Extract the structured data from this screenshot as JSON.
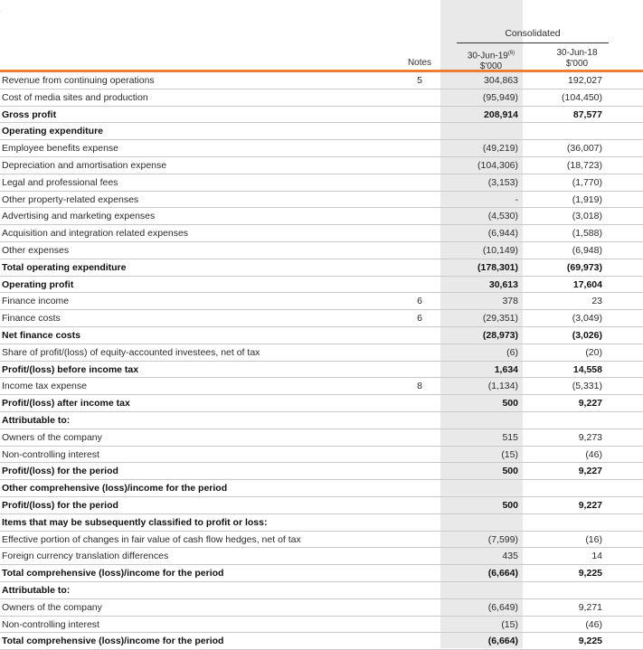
{
  "header": {
    "consolidated": "Consolidated",
    "notes": "Notes",
    "col_2019": {
      "date": "30-Jun-19",
      "sup": "(6)",
      "unit": "$'000"
    },
    "col_2018": {
      "date": "30-Jun-18",
      "unit": "$'000"
    }
  },
  "rows": [
    {
      "label": "Revenue from continuing operations",
      "note": "5",
      "v19": "304,863",
      "v18": "192,027",
      "bold": false
    },
    {
      "label": "Cost of media sites and production",
      "note": "",
      "v19": "(95,949)",
      "v18": "(104,450)",
      "bold": false
    },
    {
      "label": "Gross profit",
      "note": "",
      "v19": "208,914",
      "v18": "87,577",
      "bold": true
    },
    {
      "label": "Operating expenditure",
      "note": "",
      "v19": "",
      "v18": "",
      "bold": true
    },
    {
      "label": "Employee benefits expense",
      "note": "",
      "v19": "(49,219)",
      "v18": "(36,007)",
      "bold": false
    },
    {
      "label": "Depreciation and amortisation expense",
      "note": "",
      "v19": "(104,306)",
      "v18": "(18,723)",
      "bold": false
    },
    {
      "label": "Legal and professional fees",
      "note": "",
      "v19": "(3,153)",
      "v18": "(1,770)",
      "bold": false
    },
    {
      "label": "Other property-related expenses",
      "note": "",
      "v19": "-",
      "v18": "(1,919)",
      "bold": false
    },
    {
      "label": "Advertising and marketing expenses",
      "note": "",
      "v19": "(4,530)",
      "v18": "(3,018)",
      "bold": false
    },
    {
      "label": "Acquisition and integration related expenses",
      "note": "",
      "v19": "(6,944)",
      "v18": "(1,588)",
      "bold": false
    },
    {
      "label": "Other expenses",
      "note": "",
      "v19": "(10,149)",
      "v18": "(6,948)",
      "bold": false
    },
    {
      "label": "Total operating expenditure",
      "note": "",
      "v19": "(178,301)",
      "v18": "(69,973)",
      "bold": true
    },
    {
      "label": "Operating profit",
      "note": "",
      "v19": "30,613",
      "v18": "17,604",
      "bold": true
    },
    {
      "label": "Finance income",
      "note": "6",
      "v19": "378",
      "v18": "23",
      "bold": false
    },
    {
      "label": "Finance costs",
      "note": "6",
      "v19": "(29,351)",
      "v18": "(3,049)",
      "bold": false
    },
    {
      "label": "Net finance costs",
      "note": "",
      "v19": "(28,973)",
      "v18": "(3,026)",
      "bold": true
    },
    {
      "label": "Share of profit/(loss) of equity-accounted investees, net of tax",
      "note": "",
      "v19": "(6)",
      "v18": "(20)",
      "bold": false
    },
    {
      "label": "Profit/(loss) before income tax",
      "note": "",
      "v19": "1,634",
      "v18": "14,558",
      "bold": true
    },
    {
      "label": "Income tax expense",
      "note": "8",
      "v19": "(1,134)",
      "v18": "(5,331)",
      "bold": false
    },
    {
      "label": "Profit/(loss) after income tax",
      "note": "",
      "v19": "500",
      "v18": "9,227",
      "bold": true
    },
    {
      "label": "Attributable to:",
      "note": "",
      "v19": "",
      "v18": "",
      "bold": true
    },
    {
      "label": "Owners of the company",
      "note": "",
      "v19": "515",
      "v18": "9,273",
      "bold": false
    },
    {
      "label": "Non-controlling interest",
      "note": "",
      "v19": "(15)",
      "v18": "(46)",
      "bold": false
    },
    {
      "label": "Profit/(loss) for the period",
      "note": "",
      "v19": "500",
      "v18": "9,227",
      "bold": true
    },
    {
      "label": "Other comprehensive (loss)/income for the period",
      "note": "",
      "v19": "",
      "v18": "",
      "bold": true
    },
    {
      "label": "Profit/(loss) for the period",
      "note": "",
      "v19": "500",
      "v18": "9,227",
      "bold": true
    },
    {
      "label": "Items that may be subsequently classified to profit or loss:",
      "note": "",
      "v19": "",
      "v18": "",
      "bold": true
    },
    {
      "label": "Effective portion of changes in fair value of cash flow hedges, net of tax",
      "note": "",
      "v19": "(7,599)",
      "v18": "(16)",
      "bold": false
    },
    {
      "label": "Foreign currency translation differences",
      "note": "",
      "v19": "435",
      "v18": "14",
      "bold": false
    },
    {
      "label": "Total comprehensive (loss)/income for the period",
      "note": "",
      "v19": "(6,664)",
      "v18": "9,225",
      "bold": true
    },
    {
      "label": "Attributable to:",
      "note": "",
      "v19": "",
      "v18": "",
      "bold": true
    },
    {
      "label": "Owners of the company",
      "note": "",
      "v19": "(6,649)",
      "v18": "9,271",
      "bold": false
    },
    {
      "label": "Non-controlling interest",
      "note": "",
      "v19": "(15)",
      "v18": "(46)",
      "bold": false
    },
    {
      "label": "Total comprehensive (loss)/income for the period",
      "note": "",
      "v19": "(6,664)",
      "v18": "9,225",
      "bold": true
    }
  ]
}
